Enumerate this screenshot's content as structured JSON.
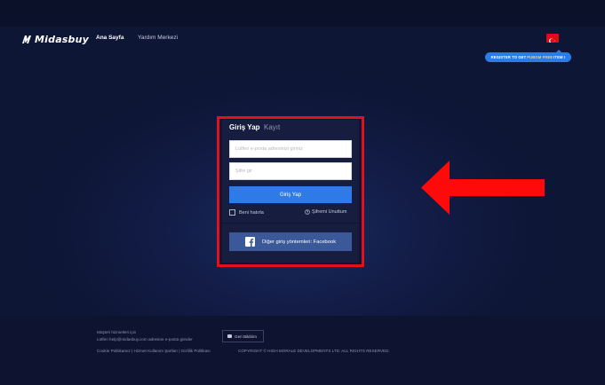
{
  "header": {
    "logo_text": "Midasbuy",
    "nav": [
      {
        "label": "Ana Sayfa"
      },
      {
        "label": "Yardım Merkezi"
      }
    ],
    "language_flag": "turkey-flag-icon",
    "promo": {
      "before": "REGISTER TO GET",
      "highlight": "PUBGM FREE",
      "after": "ITEM !"
    }
  },
  "login": {
    "tabs": [
      {
        "label": "Giriş Yap",
        "active": true
      },
      {
        "label": "Kayıt",
        "active": false
      }
    ],
    "email_placeholder": "Lütfen e-posta adresinizi giriniz",
    "password_placeholder": "Şifre gir",
    "login_button": "Giriş Yap",
    "remember_label": "Beni hatırla",
    "forgot_label": "Şifremi Unuttum",
    "facebook_button": "Diğer giriş yöntemleri: Facebook"
  },
  "footer": {
    "service_title": "Müşteri hizmetleri için",
    "service_email_line": "Lütfen help@midasbuy.com adresine e-posta gönder",
    "feedback_button": "Geri Bildirim",
    "links_line": "Cookie Politikamız | Hizmet Kullanım Şartları | Gizlilik Politikası",
    "copyright": "COPYRIGHT © HIGH MORALE DEVELOPMENTS LTD. ALL RIGHTS RESERVED."
  },
  "colors": {
    "annotation_frame": "#e1101a",
    "annotation_arrow": "#ff0a0a",
    "primary_button": "#2e7ae6",
    "facebook_button": "#3b5998"
  }
}
